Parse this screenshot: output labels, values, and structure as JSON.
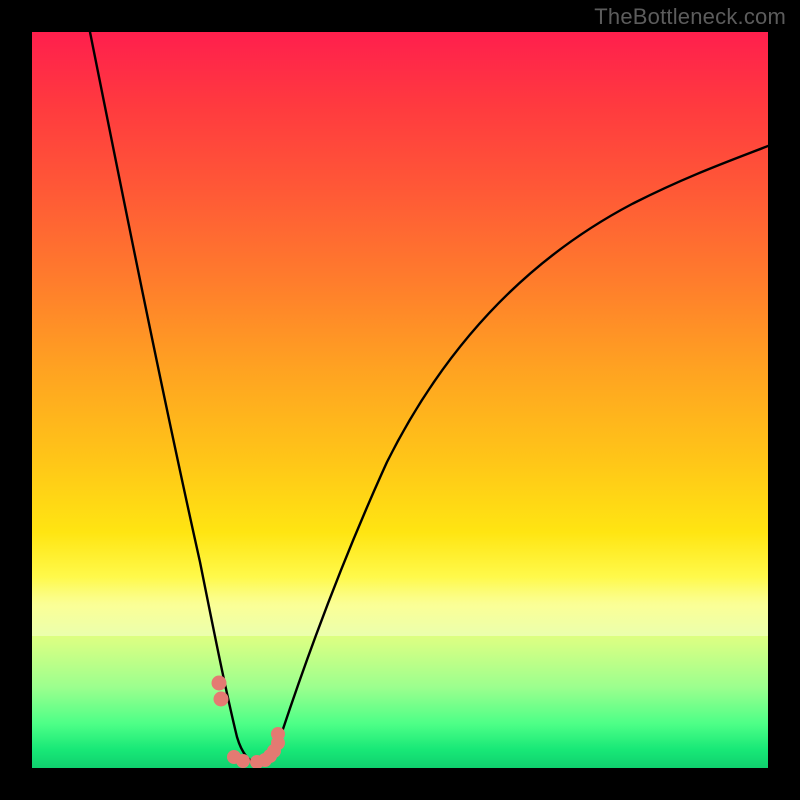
{
  "watermark": "TheBottleneck.com",
  "colors": {
    "background": "#000000",
    "gradient_top": "#ff1f4d",
    "gradient_mid": "#ffe512",
    "gradient_bottom": "#18e877",
    "curve": "#000000",
    "markers": "#e47a72"
  },
  "chart_data": {
    "type": "line",
    "title": "",
    "xlabel": "",
    "ylabel": "",
    "xlim": [
      0,
      100
    ],
    "ylim": [
      0,
      100
    ],
    "series": [
      {
        "name": "left-branch",
        "x": [
          8,
          10,
          12,
          14,
          16,
          18,
          20,
          22,
          23.5,
          25,
          26,
          27,
          27.8
        ],
        "y": [
          100,
          87,
          74,
          62,
          50,
          39,
          29,
          19,
          12,
          7,
          4,
          2,
          0.6
        ]
      },
      {
        "name": "right-branch",
        "x": [
          32.5,
          34,
          36,
          39,
          43,
          48,
          54,
          61,
          69,
          78,
          88,
          100
        ],
        "y": [
          0.6,
          2.5,
          6,
          12,
          20,
          29,
          38,
          47,
          55,
          63,
          70,
          77
        ]
      },
      {
        "name": "valley-floor",
        "x": [
          27.8,
          29,
          30.5,
          32.5
        ],
        "y": [
          0.6,
          0.3,
          0.3,
          0.6
        ]
      }
    ],
    "markers": {
      "name": "scatter-points",
      "x": [
        25.4,
        25.6,
        27.4,
        28.6,
        30.5,
        31.6,
        32.2,
        32.8,
        33.4,
        33.4
      ],
      "y": [
        11.5,
        9.4,
        1.2,
        0.6,
        0.6,
        0.9,
        1.4,
        2.1,
        3.2,
        4.4
      ]
    }
  }
}
